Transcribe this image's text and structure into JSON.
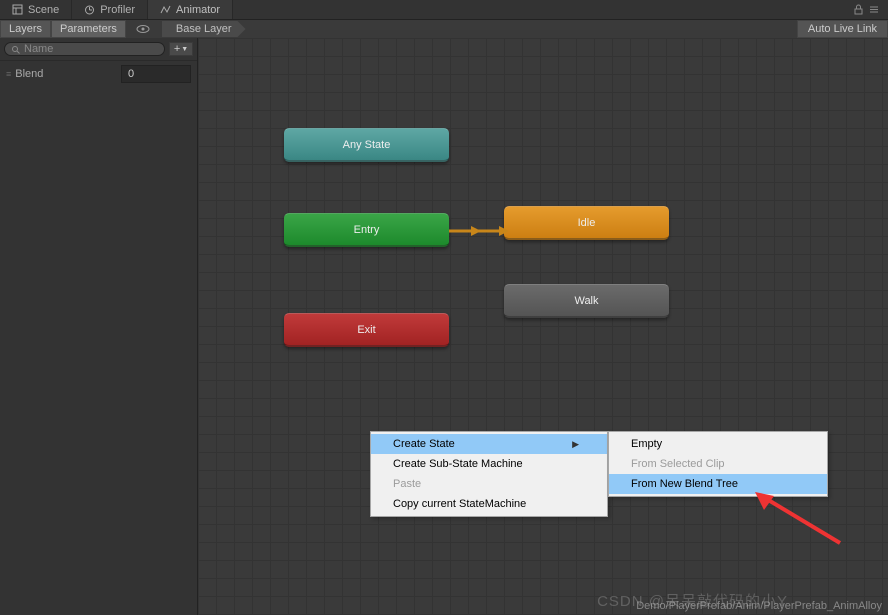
{
  "tabs": {
    "scene": "Scene",
    "profiler": "Profiler",
    "animator": "Animator"
  },
  "subbar": {
    "layers": "Layers",
    "parameters": "Parameters",
    "baseLayer": "Base Layer",
    "autoLiveLink": "Auto Live Link"
  },
  "sidepanel": {
    "search_placeholder": "Name",
    "param_name": "Blend",
    "param_value": "0"
  },
  "nodes": {
    "anyState": "Any State",
    "entry": "Entry",
    "idle": "Idle",
    "walk": "Walk",
    "exit": "Exit"
  },
  "context_menu": {
    "createState": "Create State",
    "createSubState": "Create Sub-State Machine",
    "paste": "Paste",
    "copyCurrent": "Copy current StateMachine"
  },
  "submenu": {
    "empty": "Empty",
    "fromSelectedClip": "From Selected Clip",
    "fromNewBlendTree": "From New Blend Tree"
  },
  "footer": "Demo/PlayerPrefab/Anim/PlayerPrefab_AnimAlloy",
  "watermark": "CSDN @呆呆敲代码的小Y"
}
